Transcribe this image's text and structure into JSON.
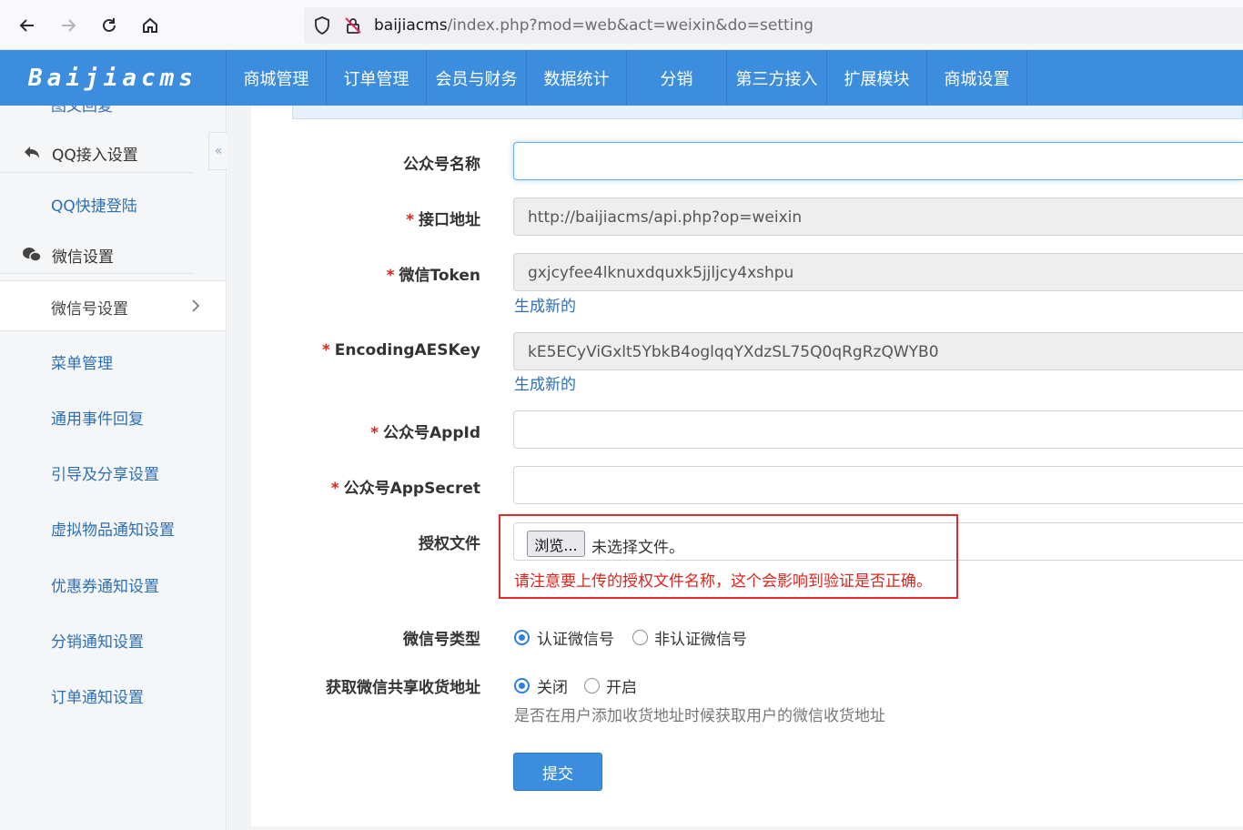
{
  "browser": {
    "url_host": "baijiacms",
    "url_path": "/index.php?mod=web&act=weixin&do=setting"
  },
  "header": {
    "logo": "Baijiacms",
    "nav": [
      "商城管理",
      "订单管理",
      "会员与财务",
      "数据统计",
      "分销",
      "第三方接入",
      "扩展模块",
      "商城设置"
    ]
  },
  "sidebar": {
    "cut_item": "图文回复",
    "groups": [
      {
        "label": "QQ接入设置",
        "icon": "reply-icon"
      },
      {
        "label": "微信设置",
        "icon": "wechat-icon"
      }
    ],
    "qq_link": "QQ快捷登陆",
    "active_item": "微信号设置",
    "links": [
      "菜单管理",
      "通用事件回复",
      "引导及分享设置",
      "虚拟物品通知设置",
      "优惠券通知设置",
      "分销通知设置",
      "订单通知设置"
    ]
  },
  "form": {
    "name_label": "公众号名称",
    "name_value": "",
    "api_label": "接口地址",
    "api_value": "http://baijiacms/api.php?op=weixin",
    "token_label": "微信Token",
    "token_value": "gxjcyfee4lknuxdquxk5jjljcy4xshpu",
    "aes_label": "EncodingAESKey",
    "aes_value": "kE5ECyViGxlt5YbkB4oglqqYXdzSL75Q0qRgRzQWYB0",
    "generate_link": "生成新的",
    "appid_label": "公众号AppId",
    "appid_value": "",
    "secret_label": "公众号AppSecret",
    "secret_value": "",
    "file_label": "授权文件",
    "file_button": "浏览...",
    "file_status": "未选择文件。",
    "file_note": "请注意要上传的授权文件名称，这个会影响到验证是否正确。",
    "type_label": "微信号类型",
    "type_options": [
      "认证微信号",
      "非认证微信号"
    ],
    "type_selected": "认证微信号",
    "address_label": "获取微信共享收货地址",
    "address_options": [
      "关闭",
      "开启"
    ],
    "address_selected": "关闭",
    "address_help": "是否在用户添加收货地址时候获取用户的微信收货地址",
    "submit": "提交"
  },
  "colors": {
    "header_blue": "#3c8dde",
    "link_blue": "#2e6fb3",
    "required_red": "#d9251d",
    "highlight_red": "#e32a2a"
  }
}
